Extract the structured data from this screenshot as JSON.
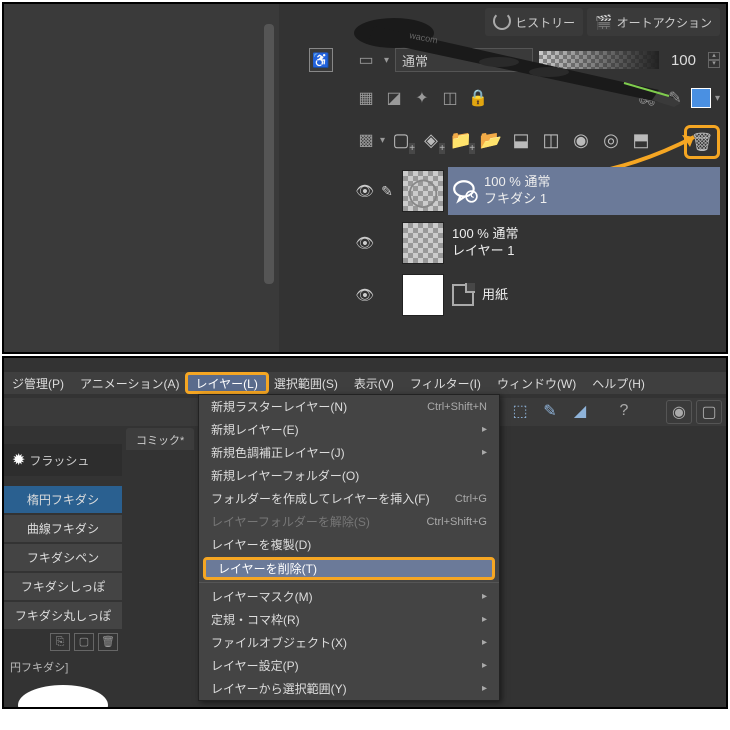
{
  "panel1": {
    "tabs": {
      "history": "ヒストリー",
      "autoaction": "オートアクション"
    },
    "blend_mode": "通常",
    "opacity": "100",
    "layers": [
      {
        "opacity_line": "100 % 通常",
        "name": "フキダシ 1",
        "selected": true,
        "type": "balloon"
      },
      {
        "opacity_line": "100 % 通常",
        "name": "レイヤー 1",
        "selected": false,
        "type": "raster"
      },
      {
        "opacity_line": "",
        "name": "用紙",
        "selected": false,
        "type": "paper"
      }
    ]
  },
  "panel2": {
    "menubar": [
      {
        "label": "ジ管理(P)"
      },
      {
        "label": "アニメーション(A)"
      },
      {
        "label": "レイヤー(L)",
        "active": true
      },
      {
        "label": "選択範囲(S)"
      },
      {
        "label": "表示(V)"
      },
      {
        "label": "フィルター(I)"
      },
      {
        "label": "ウィンドウ(W)"
      },
      {
        "label": "ヘルプ(H)"
      }
    ],
    "doc_tab": "コミック*",
    "side_header": "フラッシュ",
    "side_tools": [
      "楕円フキダシ",
      "曲線フキダシ",
      "フキダシペン",
      "フキダシしっぽ",
      "フキダシ丸しっぽ"
    ],
    "side_label": "円フキダシ]",
    "dropdown": [
      {
        "label": "新規ラスターレイヤー(N)",
        "shortcut": "Ctrl+Shift+N"
      },
      {
        "label": "新規レイヤー(E)",
        "arrow": true
      },
      {
        "label": "新規色調補正レイヤー(J)",
        "arrow": true
      },
      {
        "label": "新規レイヤーフォルダー(O)"
      },
      {
        "label": "フォルダーを作成してレイヤーを挿入(F)",
        "shortcut": "Ctrl+G"
      },
      {
        "label": "レイヤーフォルダーを解除(S)",
        "shortcut": "Ctrl+Shift+G",
        "disabled": true
      },
      {
        "label": "レイヤーを複製(D)"
      },
      {
        "label": "レイヤーを削除(T)",
        "highlighted": true
      },
      {
        "sep": true
      },
      {
        "label": "レイヤーマスク(M)",
        "arrow": true
      },
      {
        "label": "定規・コマ枠(R)",
        "arrow": true
      },
      {
        "label": "ファイルオブジェクト(X)",
        "arrow": true
      },
      {
        "label": "レイヤー設定(P)",
        "arrow": true
      },
      {
        "label": "レイヤーから選択範囲(Y)",
        "arrow": true
      }
    ]
  }
}
